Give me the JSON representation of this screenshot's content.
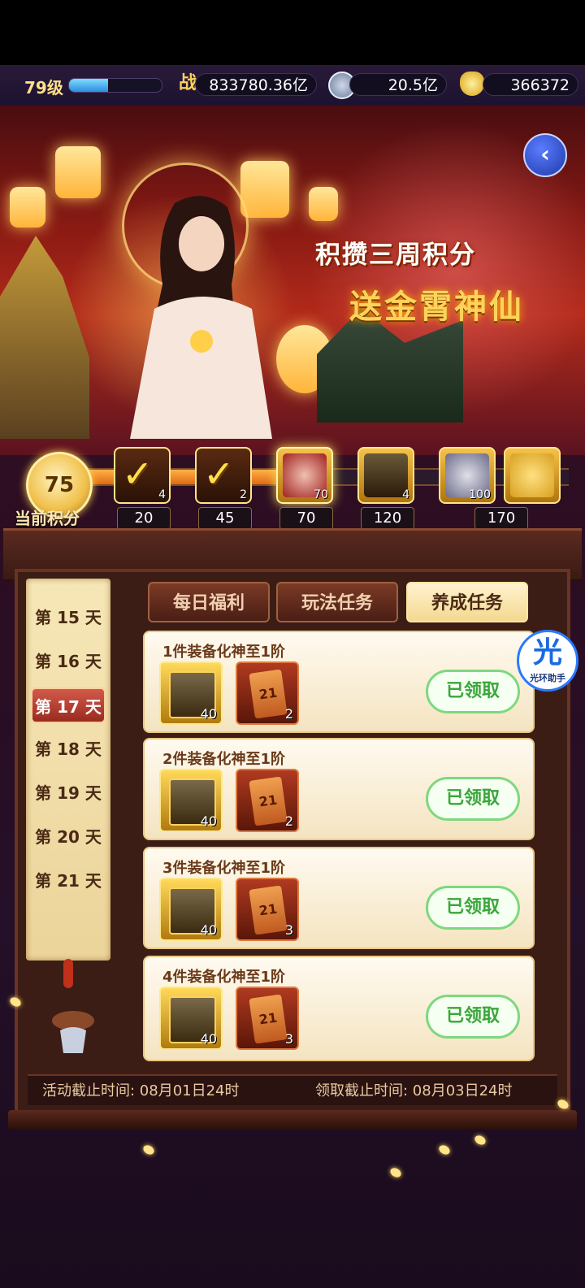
{
  "topbar": {
    "level": "79级",
    "xp_fraction": 0.42,
    "power_icon": "战",
    "power": "833780.36亿",
    "silver": "20.5亿",
    "gold": "366372"
  },
  "banner": {
    "line1": "积攒三周积分",
    "line2": "送金霄神仙"
  },
  "progress": {
    "current_points": "75",
    "current_label": "当前积分",
    "fill_fraction": 0.43,
    "milestones": [
      {
        "score": "20",
        "count": "4",
        "claimed": true
      },
      {
        "score": "45",
        "count": "2",
        "claimed": true
      },
      {
        "score": "70",
        "count": "70",
        "claimed": false
      },
      {
        "score": "120",
        "count": "4",
        "claimed": false
      },
      {
        "score": "",
        "count": "100",
        "claimed": false
      },
      {
        "score": "170",
        "count": "",
        "claimed": false
      }
    ]
  },
  "days": [
    "第 15 天",
    "第 16 天",
    "第 17 天",
    "第 18 天",
    "第 19 天",
    "第 20 天",
    "第 21 天"
  ],
  "active_day": "第 17 天",
  "tabs": [
    "每日福利",
    "玩法任务",
    "养成任务"
  ],
  "tasks": [
    {
      "title": "1件装备化神至1阶",
      "item1_count": "40",
      "item2_count": "2",
      "item2_label": "21",
      "status": "已领取"
    },
    {
      "title": "2件装备化神至1阶",
      "item1_count": "40",
      "item2_count": "2",
      "item2_label": "21",
      "status": "已领取"
    },
    {
      "title": "3件装备化神至1阶",
      "item1_count": "40",
      "item2_count": "3",
      "item2_label": "21",
      "status": "已领取"
    },
    {
      "title": "4件装备化神至1阶",
      "item1_count": "40",
      "item2_count": "3",
      "item2_label": "21",
      "status": "已领取"
    }
  ],
  "footer": {
    "activity_end": "活动截止时间: 08月01日24时",
    "claim_end": "领取截止时间: 08月03日24时"
  },
  "assistant": {
    "glyph": "光",
    "label": "光环助手"
  }
}
